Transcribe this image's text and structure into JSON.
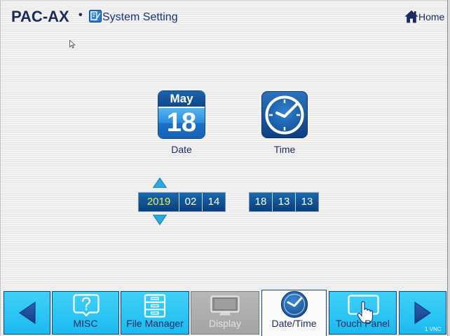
{
  "header": {
    "brand": "PAC-AX",
    "bullet": "•",
    "title": "System Setting",
    "home_label": "Home"
  },
  "date_icon": {
    "month": "May",
    "day": "18"
  },
  "shortcuts": {
    "date_label": "Date",
    "time_label": "Time"
  },
  "date_fields": [
    {
      "value": "2019",
      "selected": true
    },
    {
      "value": "02",
      "selected": false
    },
    {
      "value": "14",
      "selected": false
    }
  ],
  "time_fields": [
    {
      "value": "18"
    },
    {
      "value": "13"
    },
    {
      "value": "13"
    }
  ],
  "nav": {
    "prev_icon": "triangle-left-icon",
    "next_icon": "triangle-right-icon",
    "tabs": [
      {
        "label": "MISC",
        "icon": "question-bubble-icon",
        "active": false,
        "disabled": false
      },
      {
        "label": "File Manager",
        "icon": "file-cabinet-icon",
        "active": false,
        "disabled": false
      },
      {
        "label": "Display",
        "icon": "monitor-icon",
        "active": false,
        "disabled": true
      },
      {
        "label": "Date/Time",
        "icon": "clock-icon",
        "active": true,
        "disabled": false
      },
      {
        "label": "Touch Panel",
        "icon": "touch-panel-icon",
        "active": false,
        "disabled": false
      }
    ]
  },
  "status": {
    "vnc": "1 VNC"
  },
  "colors": {
    "brand": "#1b2a5e",
    "title": "#1c2f85",
    "tab_cyan": "#1bbaf0",
    "tab_cyan_top": "#40d0f8",
    "tab_border": "#1b3d86",
    "tab_disabled": "#a4a4a4",
    "field_bg": "#0a3f7a",
    "field_bg_top": "#1768ae",
    "field_text": "#ffffff",
    "field_selected_text": "#e8f046",
    "arrow": "#2aa9e2"
  }
}
